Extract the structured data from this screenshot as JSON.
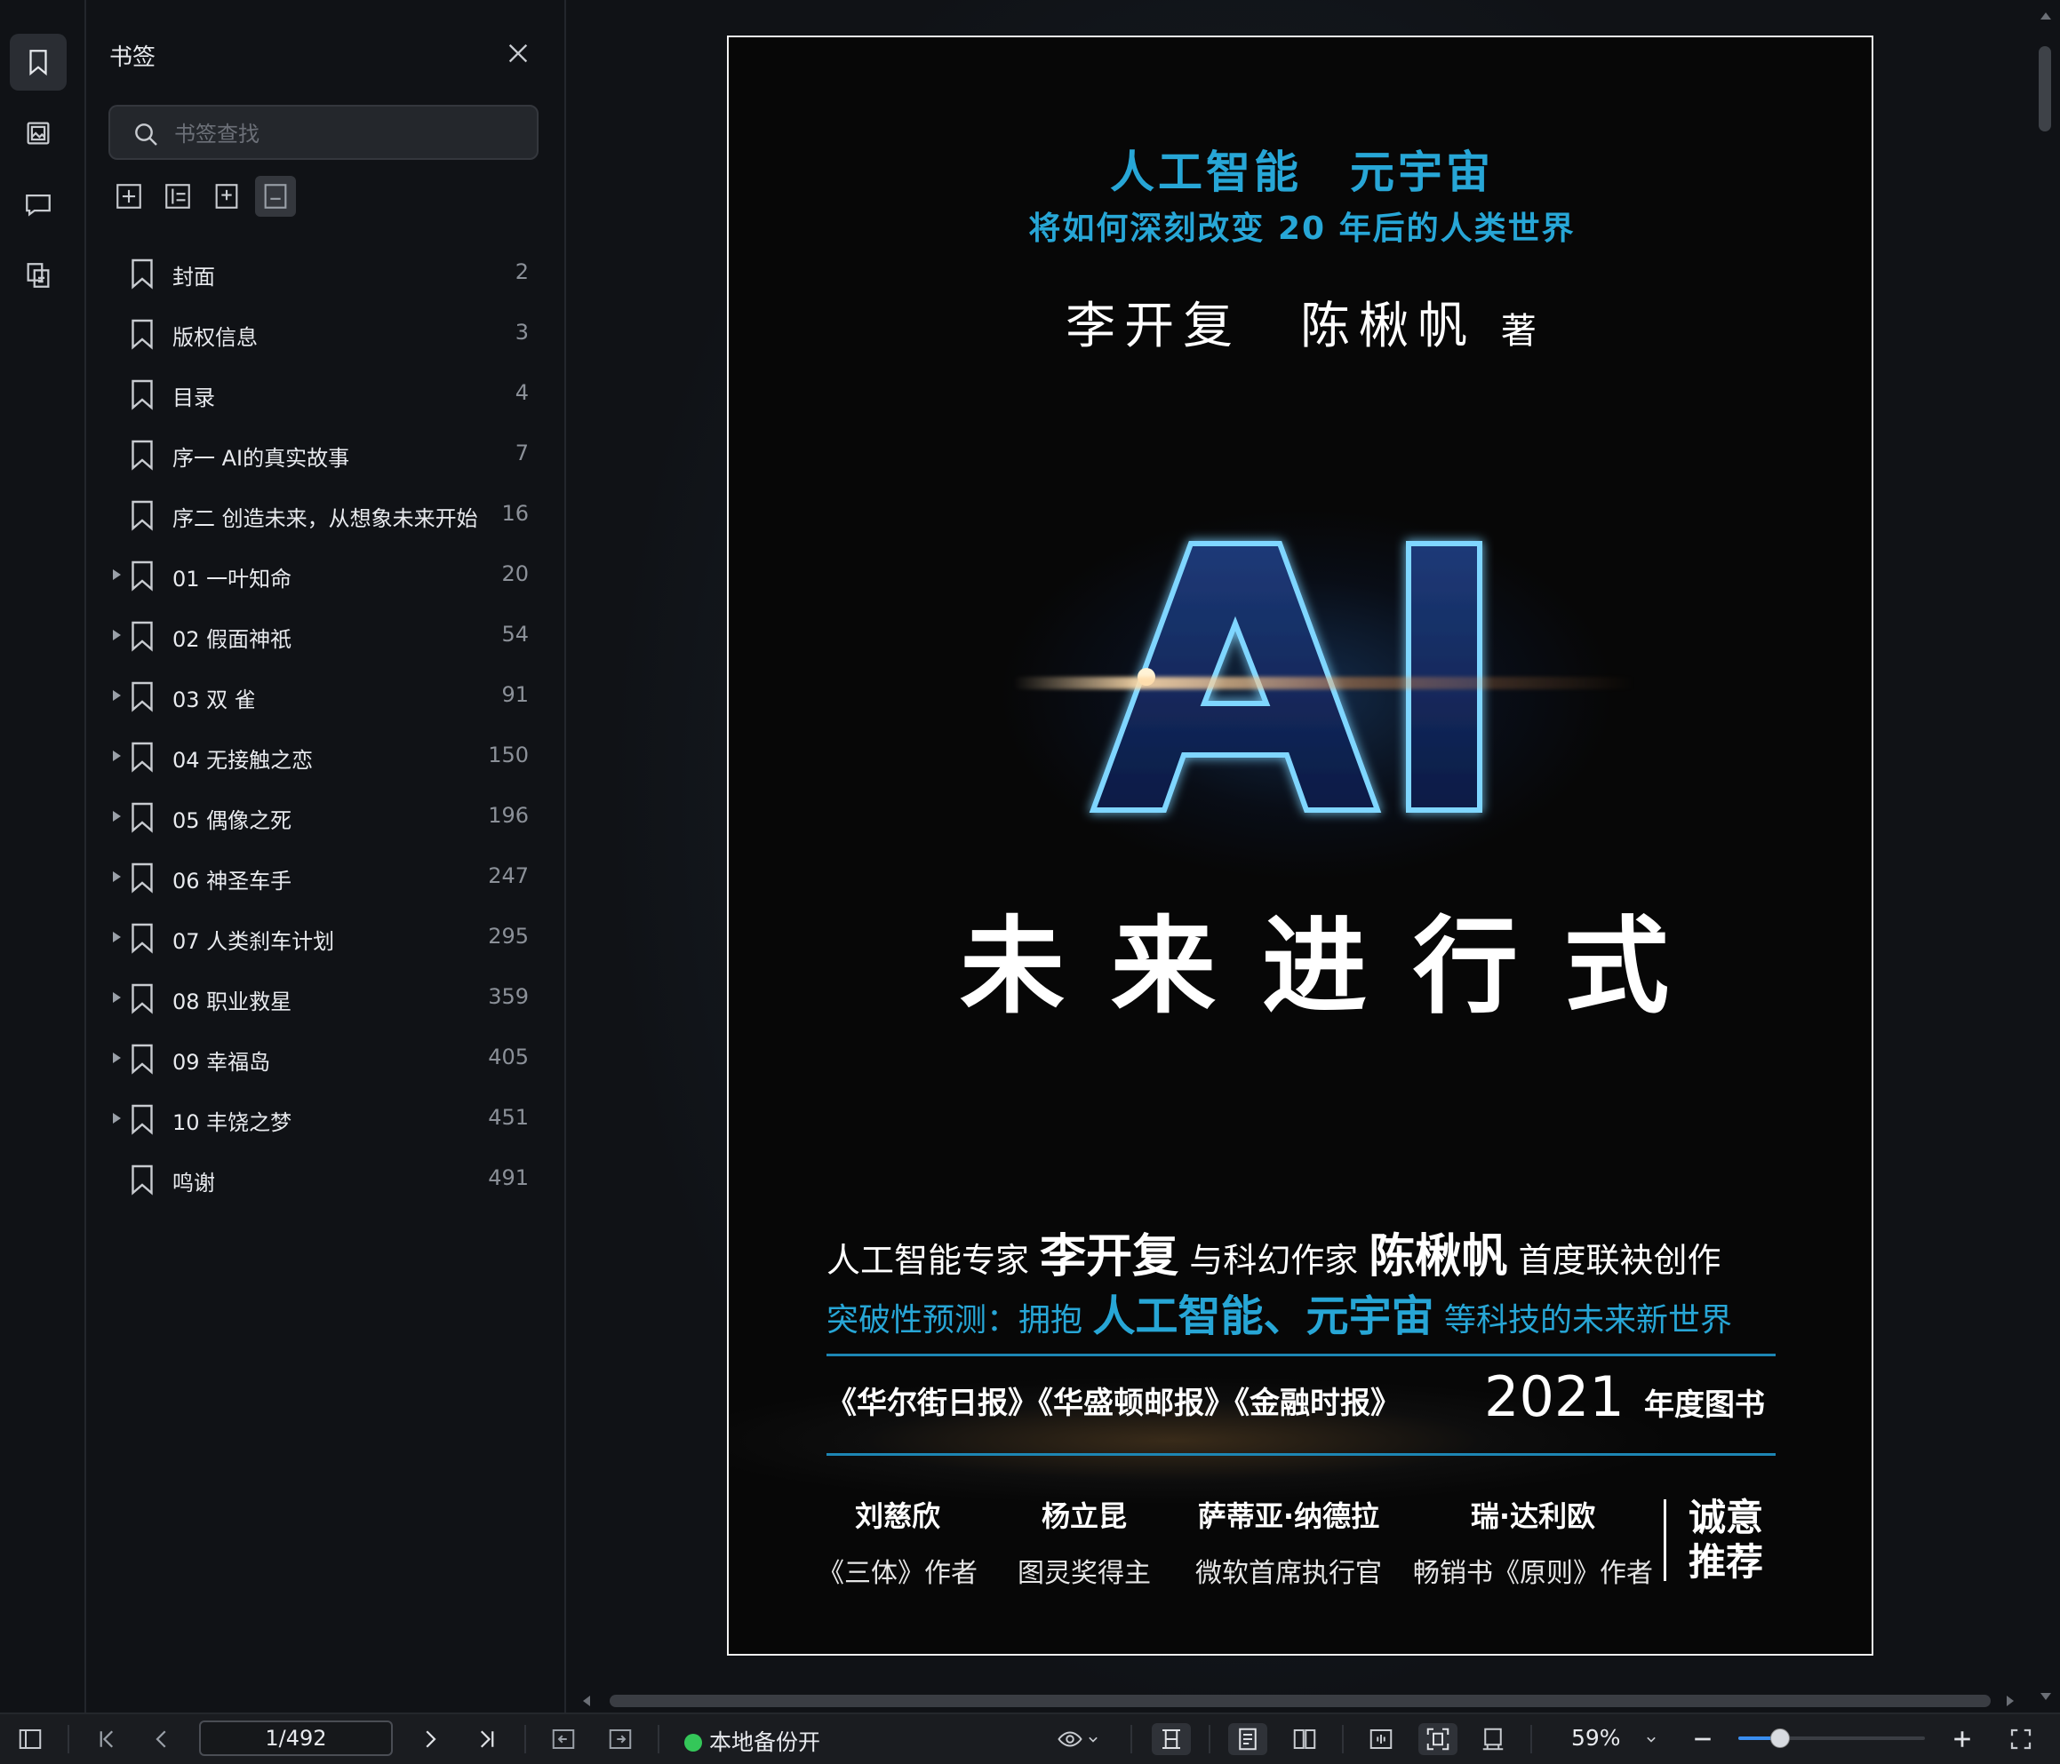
{
  "panel": {
    "title": "书签",
    "search_placeholder": "书签查找"
  },
  "bookmarks": [
    {
      "label": "封面",
      "page": "2",
      "expandable": false
    },
    {
      "label": "版权信息",
      "page": "3",
      "expandable": false
    },
    {
      "label": "目录",
      "page": "4",
      "expandable": false
    },
    {
      "label": "序一 AI的真实故事",
      "page": "7",
      "expandable": false
    },
    {
      "label": "序二 创造未来，从想象未来开始",
      "page": "16",
      "expandable": false
    },
    {
      "label": "01 一叶知命",
      "page": "20",
      "expandable": true
    },
    {
      "label": "02 假面神祇",
      "page": "54",
      "expandable": true
    },
    {
      "label": "03 双 雀",
      "page": "91",
      "expandable": true
    },
    {
      "label": "04 无接触之恋",
      "page": "150",
      "expandable": true
    },
    {
      "label": "05 偶像之死",
      "page": "196",
      "expandable": true
    },
    {
      "label": "06 神圣车手",
      "page": "247",
      "expandable": true
    },
    {
      "label": "07 人类刹车计划",
      "page": "295",
      "expandable": true
    },
    {
      "label": "08 职业救星",
      "page": "359",
      "expandable": true
    },
    {
      "label": "09 幸福岛",
      "page": "405",
      "expandable": true
    },
    {
      "label": "10 丰饶之梦",
      "page": "451",
      "expandable": true
    },
    {
      "label": "鸣谢",
      "page": "491",
      "expandable": false
    }
  ],
  "cover": {
    "line1": "人工智能　元宇宙",
    "line2": "将如何深刻改变 20 年后的人类世界",
    "authors": "李开复　陈楸帆",
    "authors_suffix": "著",
    "logo": "AI",
    "main_title": "未来进行式",
    "tag1_a": "人工智能专家",
    "tag1_b": "李开复",
    "tag1_c": "与科幻作家",
    "tag1_d": "陈楸帆",
    "tag1_e": "首度联袂创作",
    "tag2_a": "突破性预测：拥抱",
    "tag2_b": "人工智能、元宇宙",
    "tag2_c": "等科技的未来新世界",
    "papers": "《华尔街日报》《华盛顿邮报》《金融时报》",
    "year": "2021",
    "book_of_year": "年度图书",
    "recommenders": [
      {
        "name": "刘慈欣",
        "desc": "《三体》作者"
      },
      {
        "name": "杨立昆",
        "desc": "图灵奖得主"
      },
      {
        "name": "萨蒂亚·纳德拉",
        "desc": "微软首席执行官"
      },
      {
        "name": "瑞·达利欧",
        "desc": "畅销书《原则》作者"
      }
    ],
    "recommend_1": "诚意",
    "recommend_2": "推荐"
  },
  "statusbar": {
    "page_indicator": "1/492",
    "backup_status": "本地备份开",
    "zoom": "59%",
    "zoom_level": 0.22
  },
  "colors": {
    "accent_cyan": "#27a6d6",
    "status_green": "#34c759",
    "slider_blue": "#3a8ef0"
  }
}
